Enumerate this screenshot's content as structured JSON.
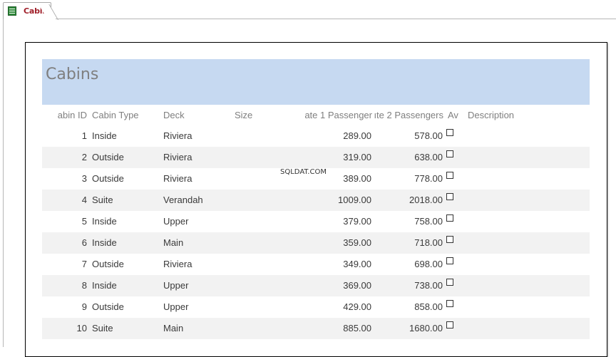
{
  "tab": {
    "label": "Cabins",
    "icon": "report-icon"
  },
  "report": {
    "title": "Cabins",
    "columns": {
      "cabin_id": "abin ID",
      "cabin_type": "Cabin Type",
      "deck": "Deck",
      "size": "Size",
      "rate1": "ate 1 Passenger",
      "rate2": "ıte 2 Passengers",
      "available": "Av",
      "description": "Description"
    },
    "rows": [
      {
        "id": "1",
        "type": "Inside",
        "deck": "Riviera",
        "rate1": "289.00",
        "rate2": "578.00",
        "available": false
      },
      {
        "id": "2",
        "type": "Outside",
        "deck": "Riviera",
        "rate1": "319.00",
        "rate2": "638.00",
        "available": false
      },
      {
        "id": "3",
        "type": "Outside",
        "deck": "Riviera",
        "rate1": "389.00",
        "rate2": "778.00",
        "available": false
      },
      {
        "id": "4",
        "type": "Suite",
        "deck": "Verandah",
        "rate1": "1009.00",
        "rate2": "2018.00",
        "available": false
      },
      {
        "id": "5",
        "type": "Inside",
        "deck": "Upper",
        "rate1": "379.00",
        "rate2": "758.00",
        "available": false
      },
      {
        "id": "6",
        "type": "Inside",
        "deck": "Main",
        "rate1": "359.00",
        "rate2": "718.00",
        "available": false
      },
      {
        "id": "7",
        "type": "Outside",
        "deck": "Riviera",
        "rate1": "349.00",
        "rate2": "698.00",
        "available": false
      },
      {
        "id": "8",
        "type": "Inside",
        "deck": "Upper",
        "rate1": "369.00",
        "rate2": "738.00",
        "available": false
      },
      {
        "id": "9",
        "type": "Outside",
        "deck": "Upper",
        "rate1": "429.00",
        "rate2": "858.00",
        "available": false
      },
      {
        "id": "10",
        "type": "Suite",
        "deck": "Main",
        "rate1": "885.00",
        "rate2": "1680.00",
        "available": false
      }
    ]
  },
  "watermark": "SQLDAT.COM",
  "colors": {
    "header_band": "#c6d9f1",
    "alt_row": "#f2f2f2",
    "tab_text": "#a0202a"
  }
}
